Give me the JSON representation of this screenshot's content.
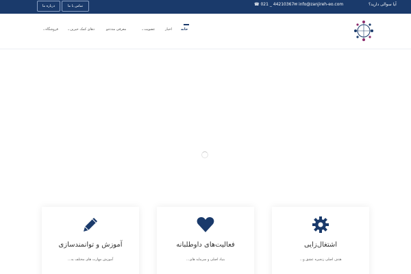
{
  "topbar": {
    "about_label": "درباره ما",
    "contact_label": "تماس با ما",
    "question": "آیا سوالی دارید؟",
    "email": "info@zanjireh-eo.com",
    "phone": "021 _ 44210367"
  },
  "nav": {
    "items": [
      {
        "label": "خانه"
      },
      {
        "label": "اخبار"
      },
      {
        "label": "عضویت"
      },
      {
        "label": "معرفی مددجو"
      },
      {
        "label": "دهای کمک خیرین"
      },
      {
        "label": "فروشگاه"
      }
    ]
  },
  "cards": [
    {
      "title": "آموزش و توانمندسازی",
      "text": "آموزش مهارت های مختلف به...",
      "icon": "pencil-icon"
    },
    {
      "title": "فعالیت‌های داوطلبانه",
      "text": "بنیاد اصلی و سرمایه های...",
      "icon": "heart-icon"
    },
    {
      "title": "اشتغال‌زایی",
      "text": "هدف اصلی زنجیره عشق و...",
      "icon": "gear-icon"
    }
  ],
  "colors": {
    "primary": "#1a3a6b",
    "accent": "#8b2a6b"
  }
}
